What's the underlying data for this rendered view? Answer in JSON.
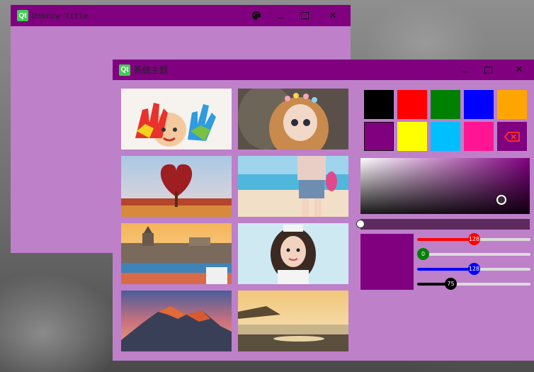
{
  "window1": {
    "title": "Unknow Title"
  },
  "window2": {
    "title": "系统主题",
    "thumbnails": [
      {
        "name": "thumb-colorful-hands"
      },
      {
        "name": "thumb-doll-girl"
      },
      {
        "name": "thumb-heart-tree"
      },
      {
        "name": "thumb-beach-doll"
      },
      {
        "name": "thumb-city-river"
      },
      {
        "name": "thumb-girl-portrait"
      },
      {
        "name": "thumb-mountain-sunset"
      },
      {
        "name": "thumb-sea-sunset"
      }
    ],
    "swatches": [
      "#000000",
      "#ff0000",
      "#008000",
      "#0000ff",
      "#ffa500",
      "#800080",
      "#ffff00",
      "#00bfff",
      "#ff1493",
      "#800080"
    ],
    "picker": {
      "current_color": "#800080",
      "sliders": [
        {
          "name": "red",
          "value": 128,
          "color": "#ff0000",
          "knob": "#ff0000",
          "label": "128"
        },
        {
          "name": "green",
          "value": 0,
          "color": "#008000",
          "knob": "#008000",
          "label": "0"
        },
        {
          "name": "blue",
          "value": 128,
          "color": "#0000ff",
          "knob": "#0000ff",
          "label": "128"
        },
        {
          "name": "alpha",
          "value": 75,
          "color": "#000000",
          "knob": "#000000",
          "label": "75"
        }
      ]
    }
  }
}
